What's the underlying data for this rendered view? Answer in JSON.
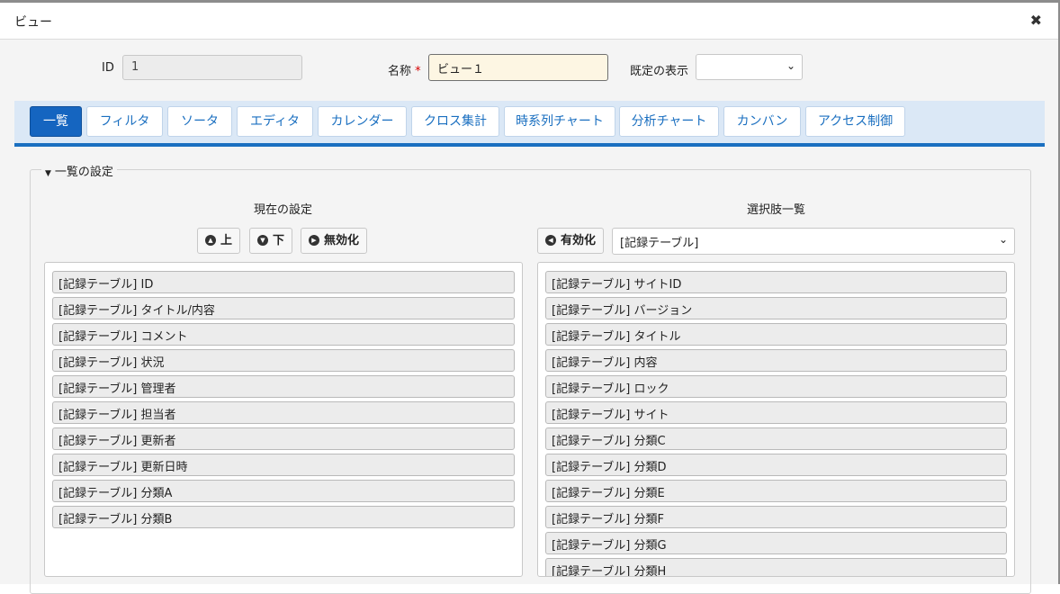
{
  "dialog": {
    "title": "ビュー"
  },
  "form": {
    "id_label": "ID",
    "id_value": "1",
    "name_label": "名称",
    "required_mark": "*",
    "name_value": "ビュー１",
    "default_display_label": "既定の表示",
    "default_display_value": ""
  },
  "tabs": [
    {
      "label": "一覧",
      "active": true
    },
    {
      "label": "フィルタ"
    },
    {
      "label": "ソータ"
    },
    {
      "label": "エディタ"
    },
    {
      "label": "カレンダー"
    },
    {
      "label": "クロス集計"
    },
    {
      "label": "時系列チャート"
    },
    {
      "label": "分析チャート"
    },
    {
      "label": "カンバン"
    },
    {
      "label": "アクセス制御"
    }
  ],
  "section": {
    "title": "一覧の設定",
    "current": {
      "heading": "現在の設定",
      "buttons": {
        "up": "上",
        "down": "下",
        "disable": "無効化"
      },
      "items": [
        "[記録テーブル] ID",
        "[記録テーブル] タイトル/内容",
        "[記録テーブル] コメント",
        "[記録テーブル] 状況",
        "[記録テーブル] 管理者",
        "[記録テーブル] 担当者",
        "[記録テーブル] 更新者",
        "[記録テーブル] 更新日時",
        "[記録テーブル] 分類A",
        "[記録テーブル] 分類B"
      ]
    },
    "options": {
      "heading": "選択肢一覧",
      "buttons": {
        "enable": "有効化"
      },
      "source_select": "[記録テーブル]",
      "items": [
        "[記録テーブル] サイトID",
        "[記録テーブル] バージョン",
        "[記録テーブル] タイトル",
        "[記録テーブル] 内容",
        "[記録テーブル] ロック",
        "[記録テーブル] サイト",
        "[記録テーブル] 分類C",
        "[記録テーブル] 分類D",
        "[記録テーブル] 分類E",
        "[記録テーブル] 分類F",
        "[記録テーブル] 分類G",
        "[記録テーブル] 分類H"
      ]
    }
  },
  "colors": {
    "accent": "#1565c0",
    "tabbar_bg": "#dbe8f6",
    "name_input_bg": "#fdf6e3"
  }
}
